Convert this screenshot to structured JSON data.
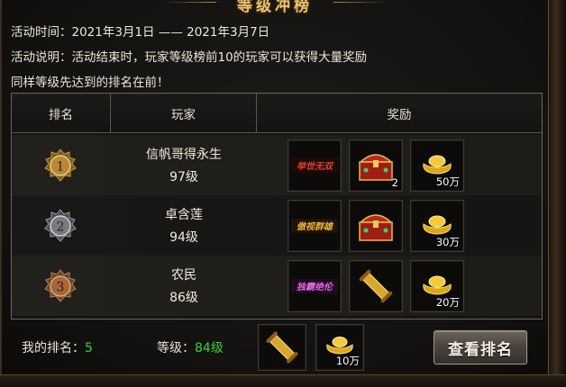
{
  "title": "等级冲榜",
  "activity": {
    "time_label": "活动时间：",
    "time_value": "2021年3月1日 —— 2021年3月7日",
    "desc_label": "活动说明：",
    "desc_value": "活动结束时，玩家等级榜前10的玩家可以获得大量奖励",
    "note": "同样等级先达到的排名在前！"
  },
  "table": {
    "headers": {
      "rank": "排名",
      "player": "玩家",
      "reward": "奖励"
    },
    "rows": [
      {
        "rank": "1",
        "medal": "gold-medal-icon",
        "player": "信帆哥得永生",
        "level": "97级",
        "rewards": [
          {
            "icon": "title-badge-icon",
            "title_text": "举世无双",
            "title_color": "#e2402f",
            "count": ""
          },
          {
            "icon": "treasure-chest-icon",
            "count": "2"
          },
          {
            "icon": "gold-ingot-icon",
            "count": "50万"
          }
        ]
      },
      {
        "rank": "2",
        "medal": "silver-medal-icon",
        "player": "卓含莲",
        "level": "94级",
        "rewards": [
          {
            "icon": "title-badge-icon",
            "title_text": "傲视群雄",
            "title_color": "#f0b23a",
            "count": ""
          },
          {
            "icon": "treasure-chest-icon",
            "count": ""
          },
          {
            "icon": "gold-ingot-icon",
            "count": "30万"
          }
        ]
      },
      {
        "rank": "3",
        "medal": "bronze-medal-icon",
        "player": "农民",
        "level": "86级",
        "rewards": [
          {
            "icon": "title-badge-icon",
            "title_text": "独霸绝伦",
            "title_color": "#e066e0",
            "count": ""
          },
          {
            "icon": "scroll-icon",
            "count": ""
          },
          {
            "icon": "gold-ingot-icon",
            "count": "20万"
          }
        ]
      }
    ]
  },
  "footer": {
    "my_rank_label": "我的排名：",
    "my_rank_value": "5",
    "level_label": "等级：",
    "level_value": "84级",
    "rewards": [
      {
        "icon": "scroll-icon",
        "count": ""
      },
      {
        "icon": "gold-ingot-icon",
        "count": "10万"
      }
    ],
    "button_label": "查看排名"
  },
  "colors": {
    "accent_gold": "#e8c374",
    "value_green": "#33d633"
  }
}
